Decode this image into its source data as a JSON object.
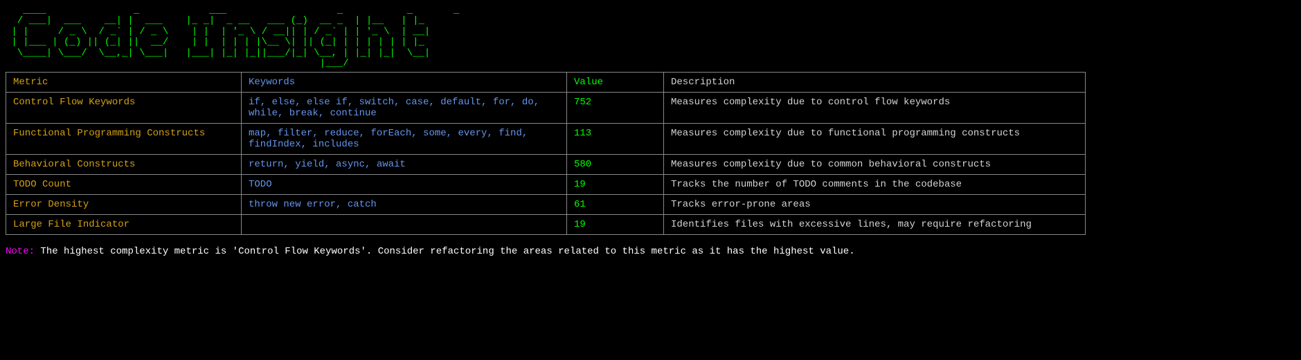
{
  "ascii_title": "   ____               _            ___                   _           _       _   \n  / ___|  ___    __| |  ___    |_ _|  _ __   ___ (_)  __ _  | |__   | |_ \n | |     / _ \\  / _` | / _ \\    | |  | '_ \\ / __|| | / _` | | '_ \\  | __|\n | |___ | (_) || (_| ||  __/    | |  | | | |\\__ \\| || (_| | | | | | | |_ \n  \\____| \\___/  \\__,_| \\___|   |___| |_| |_||___/|_| \\__, | |_| |_|  \\__|\n                                                      |___/              ",
  "headers": {
    "metric": "Metric",
    "keywords": "Keywords",
    "value": "Value",
    "description": "Description"
  },
  "rows": [
    {
      "metric": "Control Flow Keywords",
      "keywords": "if, else, else if, switch, case, default, for, do, while, break, continue",
      "value": "752",
      "description": "Measures complexity due to control flow keywords"
    },
    {
      "metric": "Functional Programming Constructs",
      "keywords": "map, filter, reduce, forEach, some, every, find, findIndex, includes",
      "value": "113",
      "description": "Measures complexity due to functional programming constructs"
    },
    {
      "metric": "Behavioral Constructs",
      "keywords": "return, yield, async, await",
      "value": "580",
      "description": "Measures complexity due to common behavioral constructs"
    },
    {
      "metric": "TODO Count",
      "keywords": "TODO",
      "value": "19",
      "description": "Tracks the number of TODO comments in the codebase"
    },
    {
      "metric": "Error Density",
      "keywords": "throw new error, catch",
      "value": "61",
      "description": "Tracks error-prone areas"
    },
    {
      "metric": "Large File Indicator",
      "keywords": "",
      "value": "19",
      "description": "Identifies files with excessive lines, may require refactoring"
    }
  ],
  "note_label": "Note:",
  "note_text": " The highest complexity metric is 'Control Flow Keywords'. Consider refactoring the areas related to this metric as it has the highest value."
}
